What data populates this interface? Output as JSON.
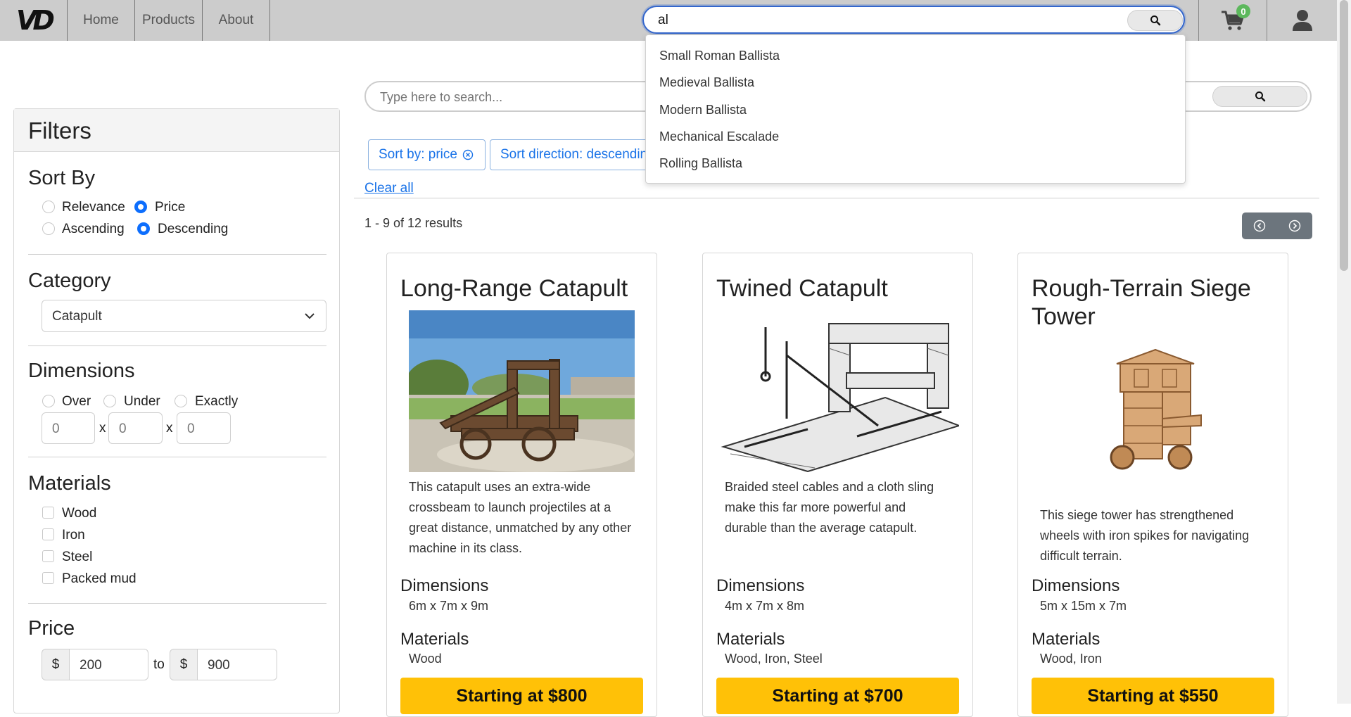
{
  "nav": {
    "logo": "VD",
    "links": [
      "Home",
      "Products",
      "About"
    ],
    "cart_count": "0"
  },
  "top_search": {
    "value": "al"
  },
  "suggestions": [
    "Small Roman Ballista",
    "Medieval Ballista",
    "Modern Ballista",
    "Mechanical Escalade",
    "Rolling Ballista"
  ],
  "main_search": {
    "placeholder": "Type here to search..."
  },
  "chips": {
    "sort_by": "Sort by: price",
    "sort_direction": "Sort direction: descending"
  },
  "clear_all": "Clear all",
  "results": "1 - 9 of 12 results",
  "filters": {
    "title": "Filters",
    "sort_by": {
      "title": "Sort By",
      "options": [
        "Relevance",
        "Price",
        "Ascending",
        "Descending"
      ],
      "selected": [
        "Price",
        "Descending"
      ]
    },
    "category": {
      "title": "Category",
      "selected": "Catapult"
    },
    "dimensions": {
      "title": "Dimensions",
      "options": [
        "Over",
        "Under",
        "Exactly"
      ],
      "values": [
        "0",
        "0",
        "0"
      ],
      "separator": "x"
    },
    "materials": {
      "title": "Materials",
      "options": [
        "Wood",
        "Iron",
        "Steel",
        "Packed mud"
      ]
    },
    "price": {
      "title": "Price",
      "currency": "$",
      "min": "200",
      "to": "to",
      "max": "900"
    }
  },
  "card_labels": {
    "dimensions": "Dimensions",
    "materials": "Materials"
  },
  "products": [
    {
      "title": "Long-Range Catapult",
      "description": "This catapult uses an extra-wide crossbeam to launch projectiles at a great distance, unmatched by any other machine in its class.",
      "dimensions": "6m x 7m x 9m",
      "materials": "Wood",
      "price": "Starting at $800"
    },
    {
      "title": "Twined Catapult",
      "description": "Braided steel cables and a cloth sling make this far more powerful and durable than the average catapult.",
      "dimensions": "4m x 7m x 8m",
      "materials": "Wood, Iron, Steel",
      "price": "Starting at $700"
    },
    {
      "title": "Rough-Terrain Siege Tower",
      "description": "This siege tower has strengthened wheels with iron spikes for navigating difficult terrain.",
      "dimensions": "5m x 15m x 7m",
      "materials": "Wood, Iron",
      "price": "Starting at $550"
    }
  ]
}
